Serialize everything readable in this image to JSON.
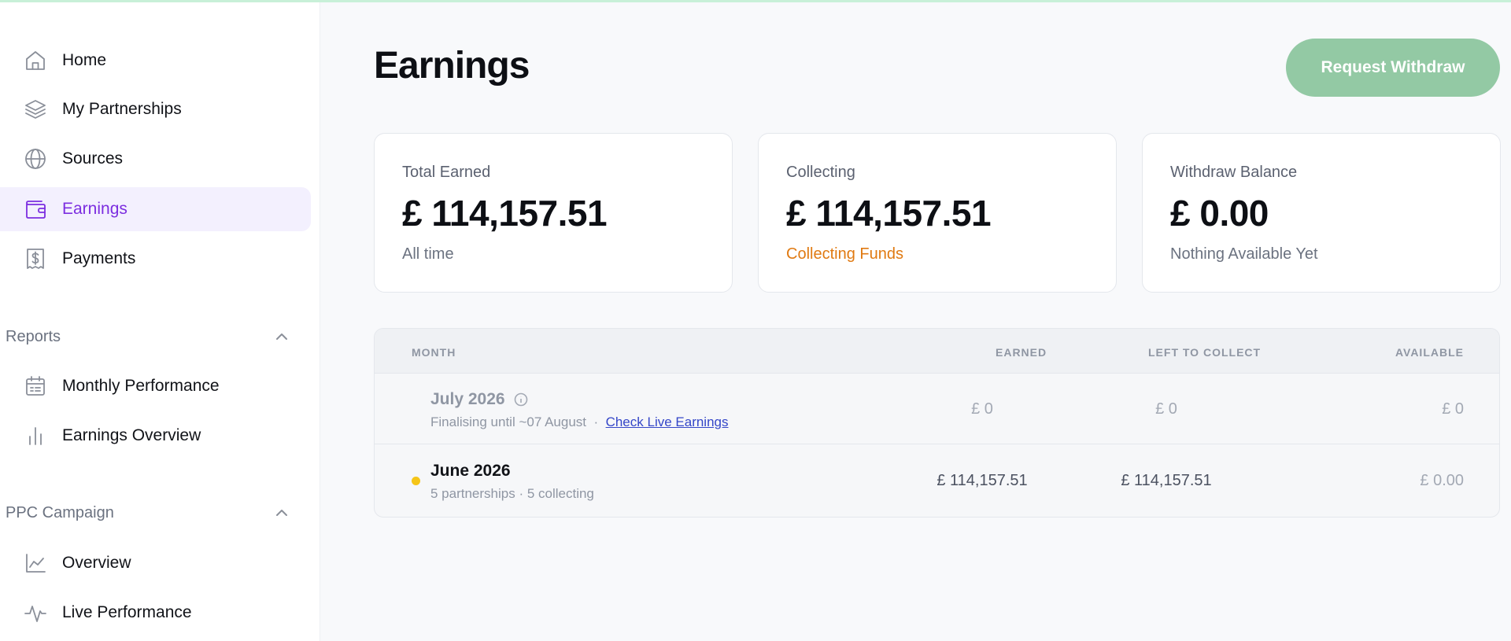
{
  "sidebar": {
    "main_items": [
      {
        "label": "Home",
        "icon": "home-icon"
      },
      {
        "label": "My Partnerships",
        "icon": "layers-icon"
      },
      {
        "label": "Sources",
        "icon": "globe-icon"
      },
      {
        "label": "Earnings",
        "icon": "wallet-icon",
        "active": true
      },
      {
        "label": "Payments",
        "icon": "receipt-dollar-icon"
      }
    ],
    "reports": {
      "title": "Reports",
      "items": [
        {
          "label": "Monthly Performance",
          "icon": "calendar-icon"
        },
        {
          "label": "Earnings Overview",
          "icon": "bar-chart-icon"
        }
      ]
    },
    "ppc": {
      "title": "PPC Campaign",
      "items": [
        {
          "label": "Overview",
          "icon": "line-chart-icon"
        },
        {
          "label": "Live Performance",
          "icon": "activity-icon"
        }
      ]
    }
  },
  "header": {
    "title": "Earnings",
    "withdraw_button": "Request Withdraw"
  },
  "cards": [
    {
      "label": "Total Earned",
      "value": "£ 114,157.51",
      "sub": "All time"
    },
    {
      "label": "Collecting",
      "value": "£ 114,157.51",
      "sub": "Collecting Funds"
    },
    {
      "label": "Withdraw Balance",
      "value": "£ 0.00",
      "sub": "Nothing Available Yet"
    }
  ],
  "table": {
    "columns": [
      "MONTH",
      "EARNED",
      "LEFT TO COLLECT",
      "AVAILABLE"
    ],
    "rows": [
      {
        "month": "July 2026",
        "meta": "Finalising until ~07 August",
        "separator": "·",
        "link": "Check Live Earnings",
        "earned": "£ 0",
        "left": "£ 0",
        "available": "£ 0"
      },
      {
        "month": "June 2026",
        "meta": "5 partnerships · 5 collecting",
        "earned": "£ 114,157.51",
        "left": "£ 114,157.51",
        "available": "£ 0.00"
      }
    ]
  },
  "colors": {
    "accent": "#7c2ee0",
    "button": "#93c9a4",
    "collecting": "#e07a12",
    "status_dot": "#f5c518"
  }
}
